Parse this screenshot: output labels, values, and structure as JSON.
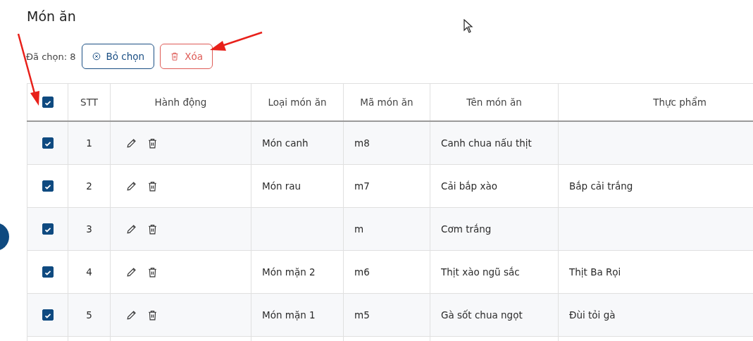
{
  "title": "Món ăn",
  "selection": {
    "label": "Đã chọn: 8",
    "buttons": [
      {
        "label": "Bỏ chọn",
        "kind": "clear"
      },
      {
        "label": "Xóa",
        "kind": "delete"
      }
    ]
  },
  "table": {
    "header_checked": true,
    "columns": [
      "STT",
      "Hành động",
      "Loại món ăn",
      "Mã món ăn",
      "Tên món ăn",
      "Thực phẩm"
    ],
    "rows": [
      {
        "checked": true,
        "stt": "1",
        "type": "Món canh",
        "code": "m8",
        "name": "Canh chua nấu thịt"
      },
      {
        "checked": true,
        "stt": "2",
        "type": "Món rau",
        "code": "m7",
        "name": "Cải bắp xào",
        "ingredient": "Bắp cải trắng"
      },
      {
        "checked": true,
        "stt": "3",
        "code": "m",
        "name": "Cơm trắng"
      },
      {
        "checked": true,
        "stt": "4",
        "type": "Món mặn 2",
        "code": "m6",
        "name": "Thịt xào ngũ sắc",
        "ingredient": "Thịt Ba Rọi"
      },
      {
        "checked": true,
        "stt": "5",
        "type": "Món mặn 1",
        "code": "m5",
        "name": "Gà sốt chua ngọt",
        "ingredient": "Đùi tỏi gà"
      }
    ]
  }
}
